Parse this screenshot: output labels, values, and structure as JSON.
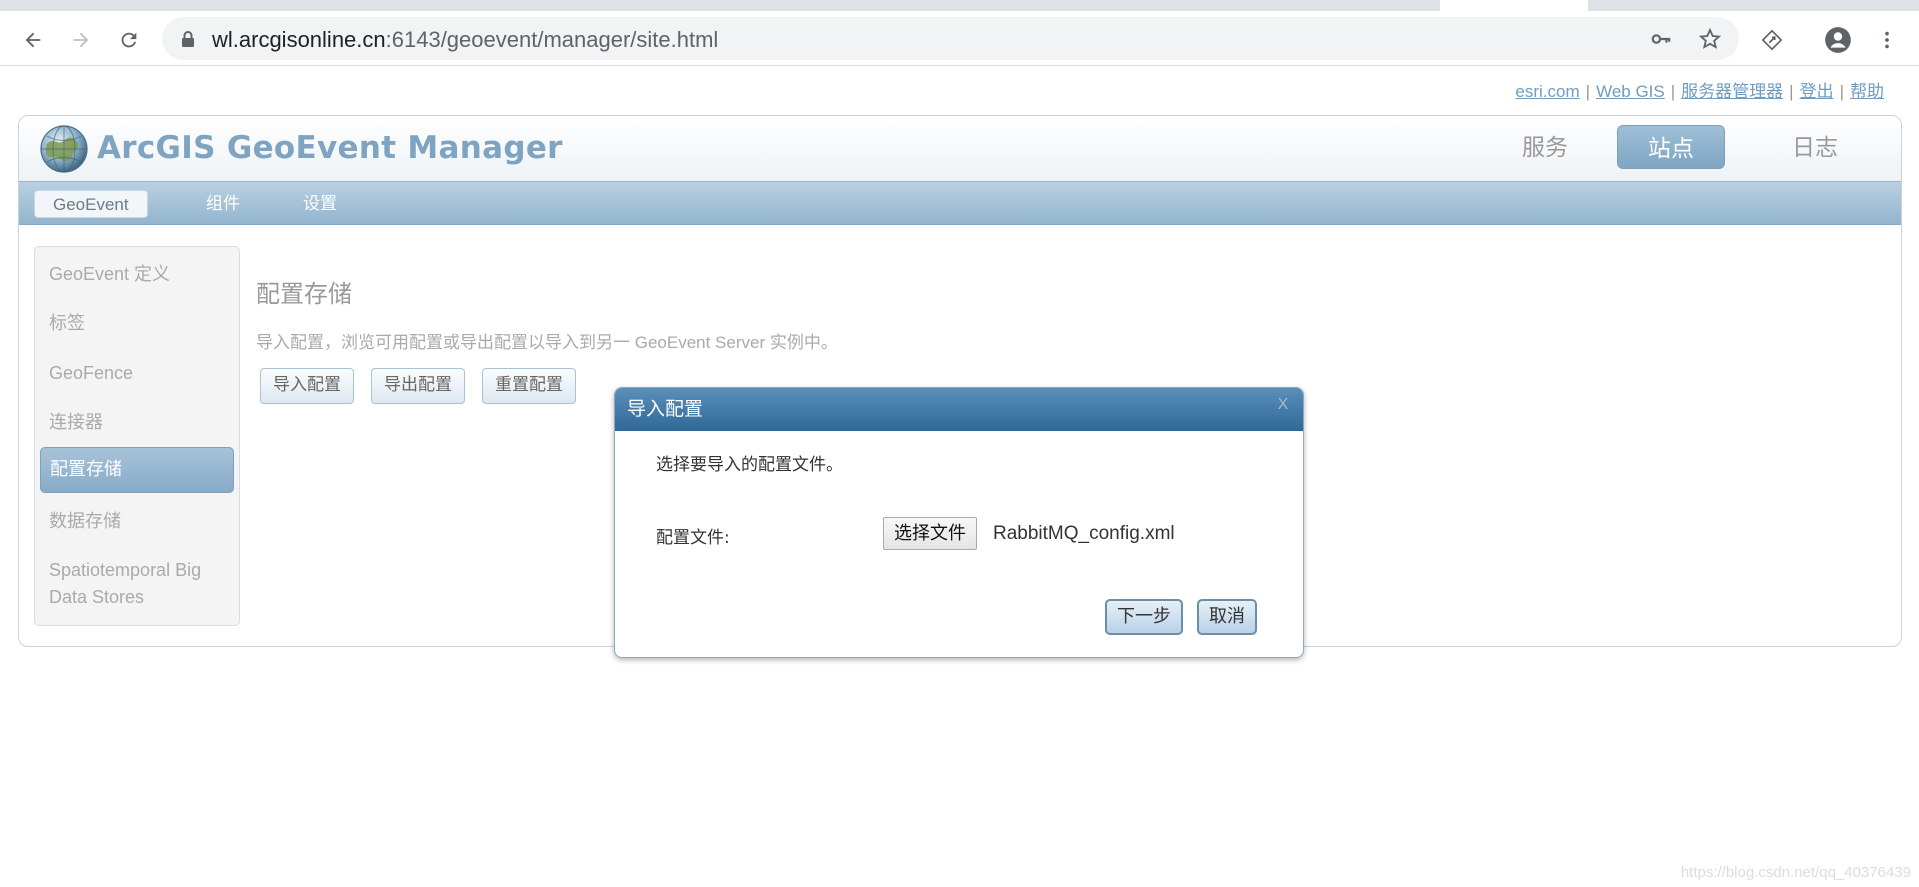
{
  "browser": {
    "url_host": "wl.arcgisonline.cn",
    "url_path": ":6143/geoevent/manager/site.html",
    "icons": [
      "back-arrow-icon",
      "forward-arrow-icon",
      "reload-icon",
      "lock-icon",
      "key-icon",
      "star-icon",
      "extension-icon",
      "account-icon",
      "more-vert-icon"
    ]
  },
  "toplinks": {
    "items": [
      "esri.com",
      "Web GIS",
      "服务器管理器",
      "登出",
      "帮助"
    ],
    "separator": "|"
  },
  "header": {
    "title": "ArcGIS GeoEvent Manager",
    "tabs": [
      {
        "label": "服务",
        "active": false
      },
      {
        "label": "站点",
        "active": true
      },
      {
        "label": "日志",
        "active": false
      }
    ]
  },
  "subnav": {
    "items": [
      {
        "label": "GeoEvent",
        "active": true
      },
      {
        "label": "组件",
        "active": false
      },
      {
        "label": "设置",
        "active": false
      }
    ]
  },
  "sidebar": {
    "items": [
      {
        "label": "GeoEvent 定义",
        "active": false
      },
      {
        "label": "标签",
        "active": false
      },
      {
        "label": "GeoFence",
        "active": false
      },
      {
        "label": "连接器",
        "active": false
      },
      {
        "label": "配置存储",
        "active": true
      },
      {
        "label": "数据存储",
        "active": false
      },
      {
        "label": "Spatiotemporal Big Data Stores",
        "active": false
      }
    ]
  },
  "content": {
    "title": "配置存储",
    "description": "导入配置，浏览可用配置或导出配置以导入到另一 GeoEvent Server 实例中。",
    "buttons": [
      "导入配置",
      "导出配置",
      "重置配置"
    ]
  },
  "dialog": {
    "title": "导入配置",
    "close_glyph": "X",
    "message": "选择要导入的配置文件。",
    "field_label": "配置文件:",
    "file_button": "选择文件",
    "file_name": "RabbitMQ_config.xml",
    "next_button": "下一步",
    "cancel_button": "取消"
  },
  "watermark": "https://blog.csdn.net/qq_40376439",
  "colors": {
    "accent": "#7ea4c2",
    "dialog_header": "#2f6896",
    "link": "#6f9cbf"
  }
}
